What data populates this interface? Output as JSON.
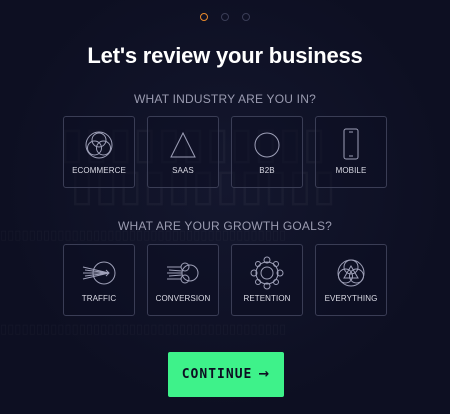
{
  "progress": {
    "steps": 3,
    "current": 1
  },
  "title": "Let's review your business",
  "industry": {
    "label": "WHAT INDUSTRY ARE YOU IN?",
    "options": [
      {
        "label": "ECOMMERCE",
        "icon": "ecommerce-icon"
      },
      {
        "label": "SAAS",
        "icon": "saas-triangle-icon"
      },
      {
        "label": "B2B",
        "icon": "b2b-circle-icon"
      },
      {
        "label": "MOBILE",
        "icon": "mobile-phone-icon"
      }
    ]
  },
  "goals": {
    "label": "WHAT ARE YOUR GROWTH GOALS?",
    "options": [
      {
        "label": "TRAFFIC",
        "icon": "traffic-icon"
      },
      {
        "label": "CONVERSION",
        "icon": "conversion-icon"
      },
      {
        "label": "RETENTION",
        "icon": "retention-icon"
      },
      {
        "label": "EVERYTHING",
        "icon": "everything-icon"
      }
    ]
  },
  "continue_button": {
    "label": "CONTINUE",
    "arrow": "→"
  },
  "colors": {
    "background": "#0d0f22",
    "active_dot": "#e8892c",
    "accent": "#3ef28a",
    "card_border": "#3a3d55"
  }
}
